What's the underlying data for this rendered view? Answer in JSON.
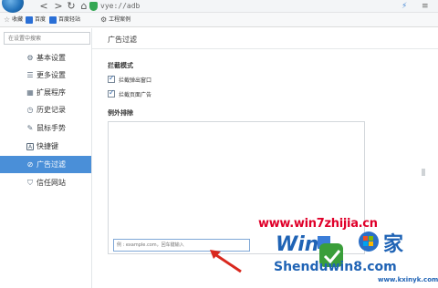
{
  "browser": {
    "url": "vye://adb",
    "nav": {
      "back": "<",
      "forward": ">",
      "reload": "↻",
      "home": "⌂"
    },
    "right_icons": {
      "bolt": "⚡",
      "menu": "≡"
    }
  },
  "bookmarks": [
    {
      "label": "收藏",
      "icon": "star-icon",
      "color": "#8a8a8a"
    },
    {
      "label": "百度",
      "icon": "page-icon",
      "color": "#2a6fd6"
    },
    {
      "label": "百度轻站",
      "icon": "page-icon",
      "color": "#2a6fd6"
    },
    {
      "label": "工程案例",
      "icon": "gear-icon",
      "color": "#555555"
    }
  ],
  "search": {
    "placeholder": "在设置中搜索"
  },
  "sidebar": {
    "items": [
      {
        "label": "基本设置",
        "icon": "⚙",
        "icon_name": "gear-icon"
      },
      {
        "label": "更多设置",
        "icon": "☰",
        "icon_name": "list-icon"
      },
      {
        "label": "扩展程序",
        "icon": "▦",
        "icon_name": "grid-icon"
      },
      {
        "label": "历史记录",
        "icon": "◷",
        "icon_name": "clock-icon"
      },
      {
        "label": "鼠标手势",
        "icon": "✎",
        "icon_name": "gesture-icon"
      },
      {
        "label": "快捷键",
        "icon": "A",
        "icon_name": "keyboard-icon"
      },
      {
        "label": "广告过滤",
        "icon": "⊘",
        "icon_name": "block-icon",
        "active": true
      },
      {
        "label": "信任网站",
        "icon": "⛉",
        "icon_name": "shield-icon"
      }
    ]
  },
  "main": {
    "title": "广告过滤",
    "block_mode": {
      "title": "拦截模式",
      "options": [
        {
          "label": "拦截弹出窗口",
          "checked": true
        },
        {
          "label": "拦截页面广告",
          "checked": true
        }
      ]
    },
    "exceptions": {
      "title": "例外排除",
      "input_placeholder": "例 : example.com，回车键输入"
    }
  },
  "watermarks": {
    "url": "www.win7zhijia.cn",
    "logo": "Shenduwin8.com",
    "small": "www.kxinyk.com"
  },
  "colors": {
    "accent": "#4a8fd8",
    "watermark_red": "#e0002a",
    "watermark_blue": "#1f63b5",
    "arrow": "#d9281e"
  }
}
